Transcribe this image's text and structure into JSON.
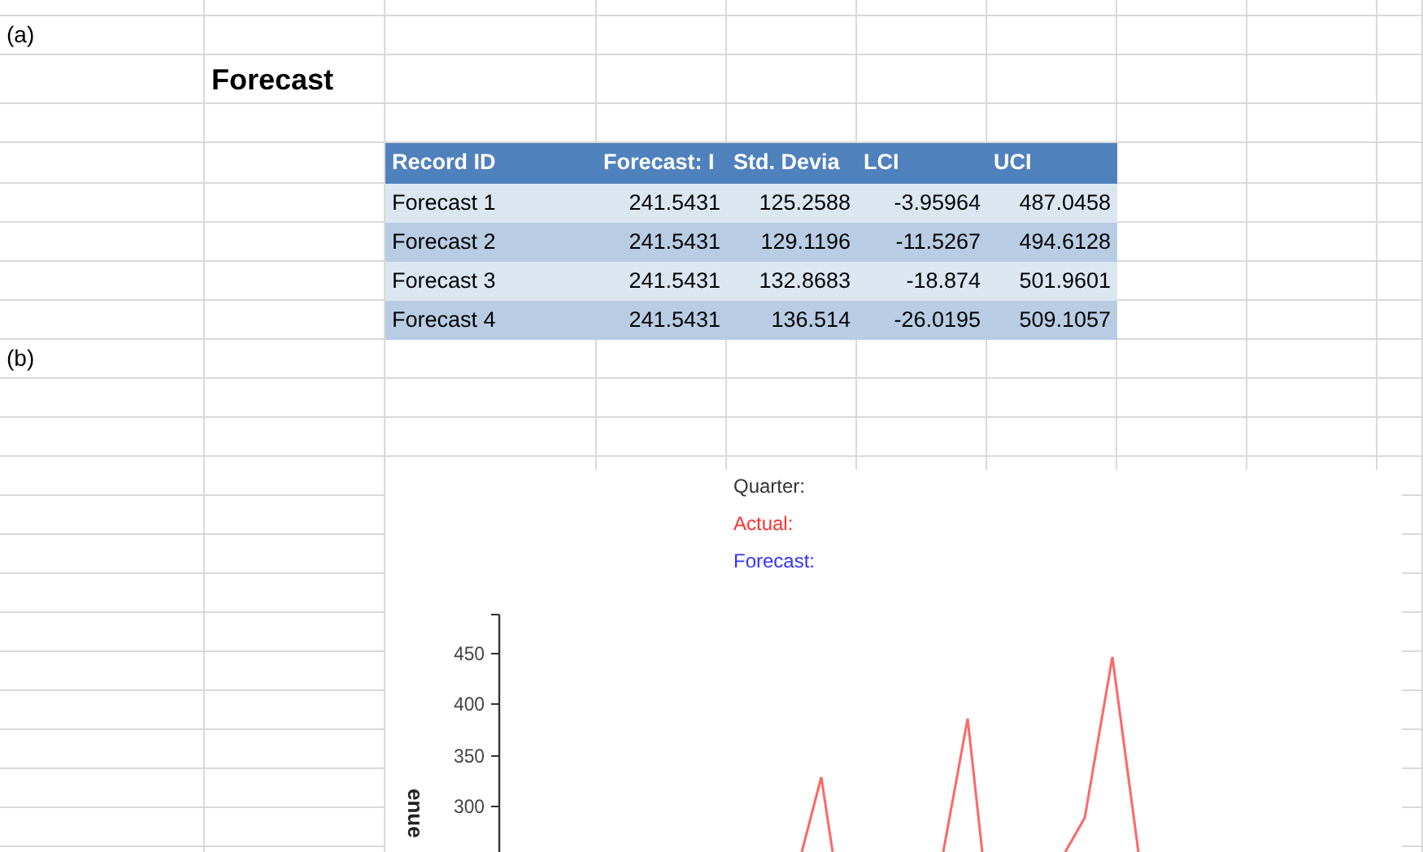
{
  "sheet": {
    "label_a": "(a)",
    "title": "Forecast",
    "label_b": "(b)"
  },
  "table": {
    "columns": [
      "Record ID",
      "Forecast: I",
      "Std. Devia",
      "LCI",
      "UCI"
    ],
    "rows": [
      [
        "Forecast 1",
        "241.5431",
        "125.2588",
        "-3.95964",
        "487.0458"
      ],
      [
        "Forecast 2",
        "241.5431",
        "129.1196",
        "-11.5267",
        "494.6128"
      ],
      [
        "Forecast 3",
        "241.5431",
        "132.8683",
        "-18.874",
        "501.9601"
      ],
      [
        "Forecast 4",
        "241.5431",
        "136.514",
        "-26.0195",
        "509.1057"
      ]
    ]
  },
  "chart": {
    "legend": [
      {
        "label": "Quarter:",
        "color": "#333333"
      },
      {
        "label": "Actual:",
        "color": "#ff3333"
      },
      {
        "label": "Forecast:",
        "color": "#3333ff"
      }
    ],
    "y_ticks": [
      "450",
      "400",
      "350",
      "300"
    ],
    "y_axis_label": "enue"
  }
}
